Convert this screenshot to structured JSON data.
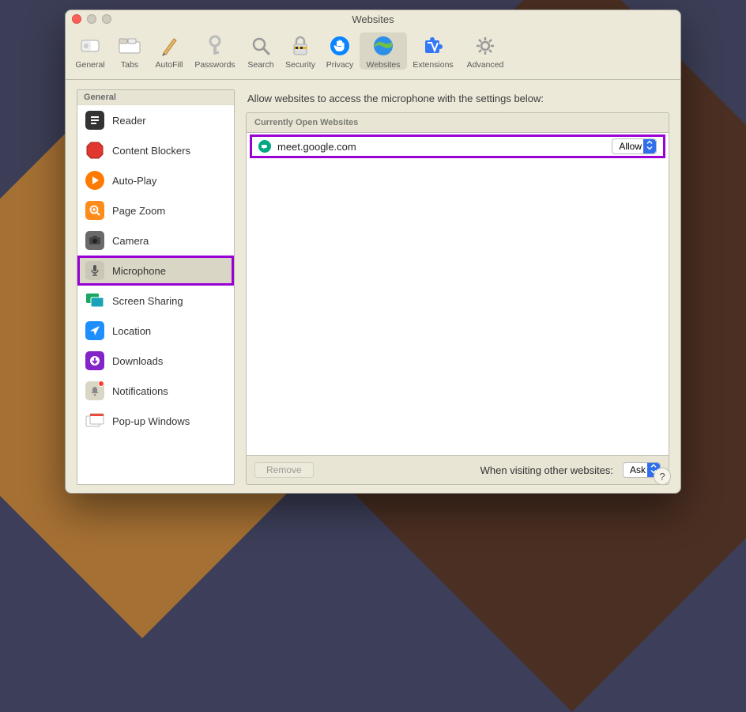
{
  "window": {
    "title": "Websites"
  },
  "toolbar": [
    {
      "id": "general",
      "label": "General"
    },
    {
      "id": "tabs",
      "label": "Tabs"
    },
    {
      "id": "autofill",
      "label": "AutoFill"
    },
    {
      "id": "passwords",
      "label": "Passwords"
    },
    {
      "id": "search",
      "label": "Search"
    },
    {
      "id": "security",
      "label": "Security"
    },
    {
      "id": "privacy",
      "label": "Privacy"
    },
    {
      "id": "websites",
      "label": "Websites",
      "active": true
    },
    {
      "id": "extensions",
      "label": "Extensions"
    },
    {
      "id": "advanced",
      "label": "Advanced"
    }
  ],
  "sidebar": {
    "header": "General",
    "items": [
      {
        "id": "reader",
        "label": "Reader"
      },
      {
        "id": "contentblockers",
        "label": "Content Blockers"
      },
      {
        "id": "autoplay",
        "label": "Auto-Play"
      },
      {
        "id": "pagezoom",
        "label": "Page Zoom"
      },
      {
        "id": "camera",
        "label": "Camera"
      },
      {
        "id": "microphone",
        "label": "Microphone",
        "selected": true
      },
      {
        "id": "screensharing",
        "label": "Screen Sharing"
      },
      {
        "id": "location",
        "label": "Location"
      },
      {
        "id": "downloads",
        "label": "Downloads"
      },
      {
        "id": "notifications",
        "label": "Notifications",
        "badge": true
      },
      {
        "id": "popups",
        "label": "Pop-up Windows"
      }
    ]
  },
  "main": {
    "heading": "Allow websites to access the microphone with the settings below:",
    "section_label": "Currently Open Websites",
    "rows": [
      {
        "site": "meet.google.com",
        "permission": "Allow"
      }
    ],
    "remove_label": "Remove",
    "footer_label": "When visiting other websites:",
    "footer_value": "Ask"
  },
  "help": "?"
}
